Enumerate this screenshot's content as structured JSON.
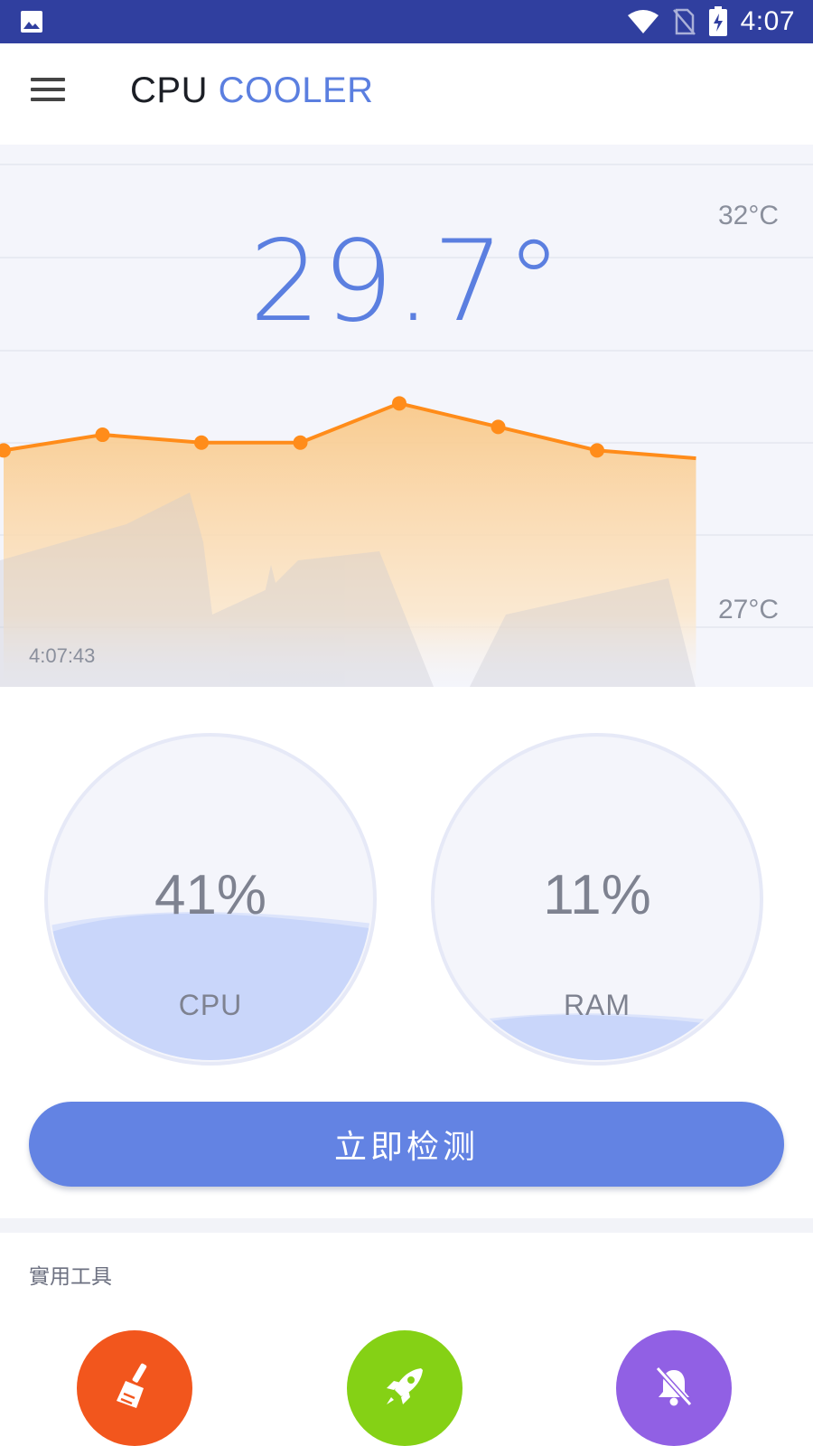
{
  "statusbar": {
    "time": "4:07",
    "icons": [
      "image-notification-icon",
      "wifi-icon",
      "no-sim-icon",
      "battery-charging-icon"
    ]
  },
  "appbar": {
    "title_part1": "CPU",
    "title_part2": "COOLER",
    "menu_icon": "hamburger-menu-icon"
  },
  "temperature": {
    "current": "29.7°",
    "max_label": "32°C",
    "min_label": "27°C",
    "timestamp": "4:07:43"
  },
  "chart_data": {
    "type": "area",
    "title": "",
    "xlabel": "",
    "ylabel": "",
    "x": [
      0,
      1,
      2,
      3,
      4,
      5,
      6,
      7
    ],
    "series": [
      {
        "values": [
          29.0,
          29.2,
          29.1,
          29.1,
          29.6,
          29.3,
          29.0,
          28.9
        ]
      }
    ],
    "ylim": [
      27,
      32
    ],
    "grid": true,
    "colors": {
      "line": "#FF8C1A",
      "fill_top": "#F9C98A",
      "fill_bottom": "#FDF0DF"
    }
  },
  "gauges": {
    "cpu": {
      "value": "41%",
      "label": "CPU",
      "level": 0.41
    },
    "ram": {
      "value": "11%",
      "label": "RAM",
      "level": 0.11
    }
  },
  "actions": {
    "detect_label": "立即检测"
  },
  "tools": {
    "section_title": "實用工具",
    "items": [
      {
        "name": "broom-icon",
        "color": "#F2561D"
      },
      {
        "name": "rocket-icon",
        "color": "#85D115"
      },
      {
        "name": "bell-off-icon",
        "color": "#9160E4"
      }
    ]
  },
  "colors": {
    "accent": "#5B7FE0",
    "statusbar": "#303F9F",
    "button": "#6383E3",
    "gauge_fill": "#C9D6FA"
  }
}
